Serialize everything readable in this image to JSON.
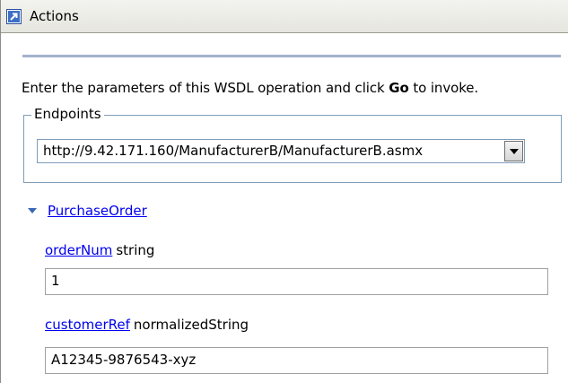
{
  "panel": {
    "title": "Actions",
    "icon": "arrow-icon"
  },
  "intro": {
    "text_before": "Enter the parameters of this WSDL operation and click ",
    "bold_word": "Go",
    "text_after": " to invoke."
  },
  "endpoints": {
    "legend": "Endpoints",
    "selected": "http://9.42.171.160/ManufacturerB/ManufacturerB.asmx"
  },
  "operation": {
    "name": "PurchaseOrder",
    "expanded": true,
    "params": [
      {
        "name": "orderNum",
        "type": "string",
        "value": "1"
      },
      {
        "name": "customerRef",
        "type": "normalizedString",
        "value": "A12345-9876543-xyz"
      }
    ]
  },
  "colors": {
    "link": "#0000ee",
    "border": "#7f9db9",
    "divider": "#a3b2cc"
  }
}
